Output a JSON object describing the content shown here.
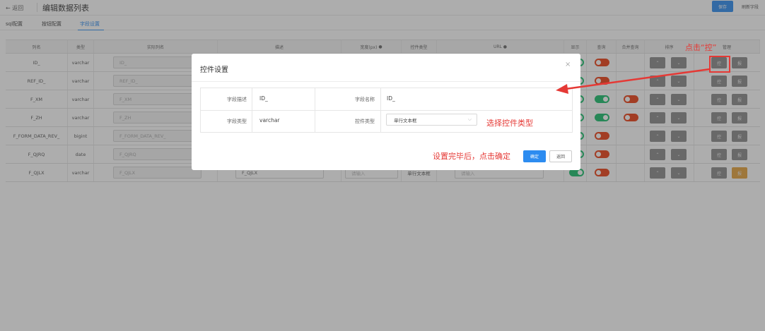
{
  "header": {
    "back_label": "← 返回",
    "title": "编辑数据列表",
    "save_label": "保存",
    "refresh_label": "刷新字段"
  },
  "tabs": [
    {
      "label": "sql配置",
      "active": false
    },
    {
      "label": "按钮配置",
      "active": false
    },
    {
      "label": "字段设置",
      "active": true
    }
  ],
  "table": {
    "columns": {
      "col_name": "列名",
      "type": "类型",
      "real_name": "实际列名",
      "desc": "描述",
      "width": "宽度(px)",
      "width_icon": "info-icon",
      "control_type": "控件类型",
      "url": "URL",
      "url_icon": "info-icon",
      "show": "显示",
      "query": "查询",
      "merge_query": "合并查询",
      "sort": "排序",
      "manage": "管理"
    },
    "rows": [
      {
        "col_name": "ID_",
        "type": "varchar",
        "real_name": "ID_",
        "show": true,
        "query": false,
        "merge_query": null,
        "manage_a": "控",
        "manage_b": "报",
        "manage_b_orange": false
      },
      {
        "col_name": "REF_ID_",
        "type": "varchar",
        "real_name": "REF_ID_",
        "show": true,
        "query": false,
        "merge_query": null,
        "manage_a": "控",
        "manage_b": "报",
        "manage_b_orange": false
      },
      {
        "col_name": "F_XM",
        "type": "varchar",
        "real_name": "F_XM",
        "show": true,
        "query": true,
        "merge_query": false,
        "manage_a": "控",
        "manage_b": "报",
        "manage_b_orange": false
      },
      {
        "col_name": "F_ZH",
        "type": "varchar",
        "real_name": "F_ZH",
        "show": true,
        "query": true,
        "merge_query": false,
        "manage_a": "控",
        "manage_b": "报",
        "manage_b_orange": false
      },
      {
        "col_name": "F_FORM_DATA_REV_",
        "type": "bigint",
        "real_name": "F_FORM_DATA_REV_",
        "show": true,
        "query": false,
        "merge_query": null,
        "manage_a": "控",
        "manage_b": "报",
        "manage_b_orange": false
      },
      {
        "col_name": "F_QJRQ",
        "type": "date",
        "real_name": "F_QJRQ",
        "show": true,
        "query": false,
        "merge_query": null,
        "manage_a": "控",
        "manage_b": "报",
        "manage_b_orange": false
      },
      {
        "col_name": "F_QJLX",
        "type": "varchar",
        "real_name": "F_QJLX",
        "desc": "F_QJLX",
        "width_placeholder": "请输入",
        "control_type": "单行文本框",
        "url_placeholder": "请输入",
        "show": true,
        "query": false,
        "merge_query": null,
        "manage_a": "控",
        "manage_b": "报",
        "manage_b_orange": true
      }
    ]
  },
  "modal": {
    "title": "控件设置",
    "close_glyph": "×",
    "field_desc_label": "字段描述",
    "field_desc_value": "ID_",
    "field_name_label": "字段名称",
    "field_name_value": "ID_",
    "field_type_label": "字段类型",
    "field_type_value": "varchar",
    "control_type_label": "控件类型",
    "control_type_value": "单行文本框",
    "ok_label": "确定",
    "return_label": "返回"
  },
  "annotations": {
    "click_hint": "点击“控”",
    "select_hint": "选择控件类型",
    "confirm_hint": "设置完毕后，点击确定",
    "color": "#e53935"
  },
  "colors": {
    "primary": "#2d8cf0",
    "switch_on": "#19be6b",
    "switch_off": "#ed3f14",
    "orange": "#e6a23c"
  }
}
